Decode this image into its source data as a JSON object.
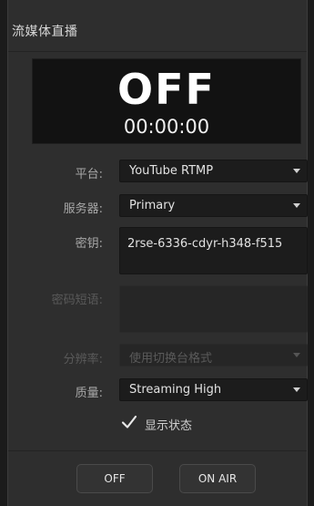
{
  "panel": {
    "title": "流媒体直播"
  },
  "status": {
    "state": "OFF",
    "timer": "00:00:00"
  },
  "fields": {
    "platform": {
      "label": "平台:",
      "value": "YouTube RTMP"
    },
    "server": {
      "label": "服务器:",
      "value": "Primary"
    },
    "key": {
      "label": "密钥:",
      "value": "2rse-6336-cdyr-h348-f515"
    },
    "passphrase": {
      "label": "密码短语:",
      "value": ""
    },
    "resolution": {
      "label": "分辨率:",
      "value": "使用切换台格式"
    },
    "quality": {
      "label": "质量:",
      "value": "Streaming High"
    }
  },
  "show_status": {
    "label": "显示状态",
    "checked": true
  },
  "buttons": {
    "off": "OFF",
    "on_air": "ON AIR"
  }
}
